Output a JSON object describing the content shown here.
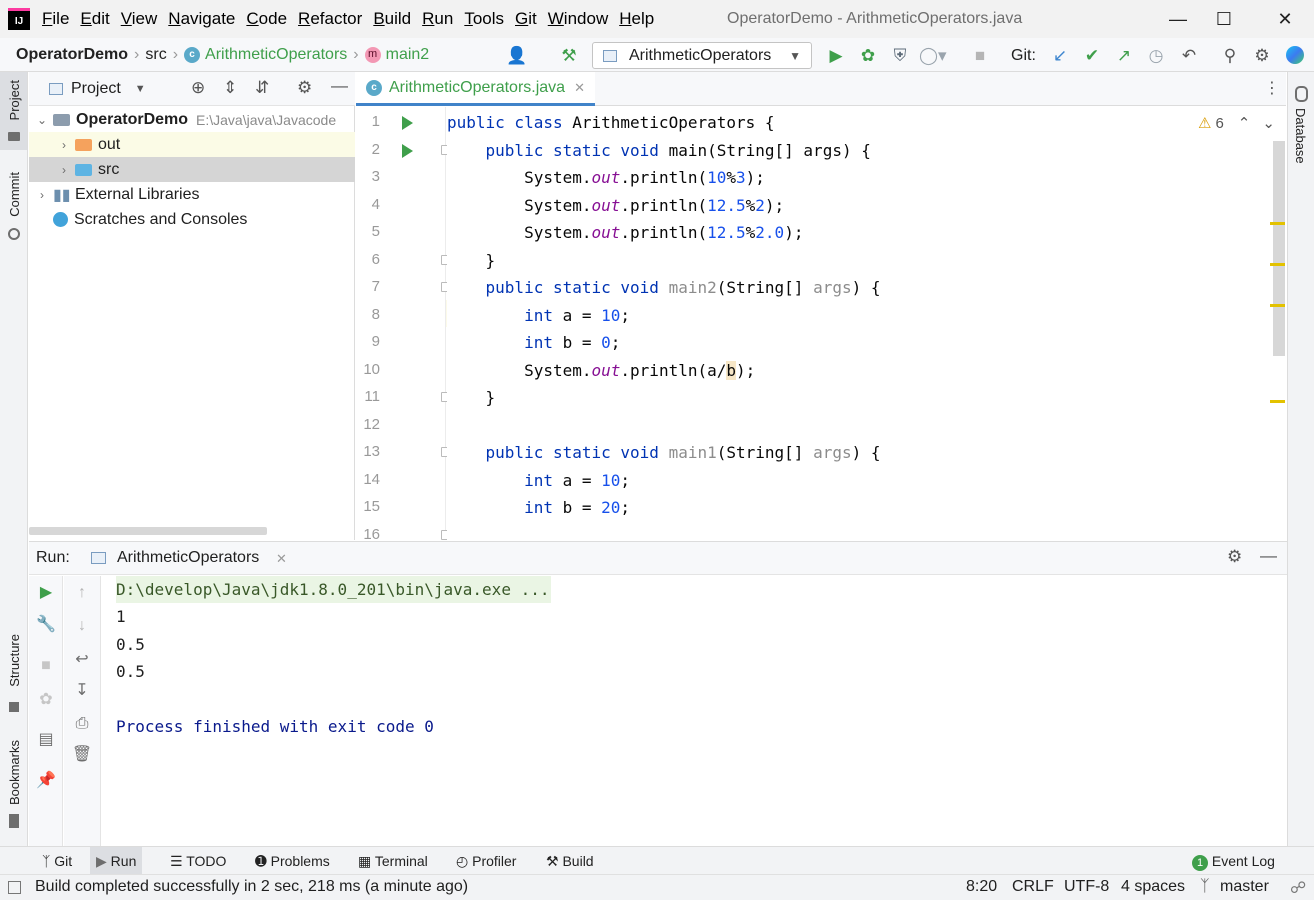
{
  "window": {
    "title": "OperatorDemo - ArithmeticOperators.java",
    "menu": [
      "File",
      "Edit",
      "View",
      "Navigate",
      "Code",
      "Refactor",
      "Build",
      "Run",
      "Tools",
      "Git",
      "Window",
      "Help"
    ]
  },
  "breadcrumb": {
    "project": "OperatorDemo",
    "folder": "src",
    "class": "ArithmeticOperators",
    "method": "main2"
  },
  "toolbar": {
    "run_config": "ArithmeticOperators",
    "git_label": "Git:"
  },
  "left_stripe": {
    "project": "Project",
    "commit": "Commit",
    "structure": "Structure",
    "bookmarks": "Bookmarks"
  },
  "right_stripe": {
    "database": "Database"
  },
  "project_panel": {
    "title": "Project",
    "tree": [
      {
        "label": "OperatorDemo",
        "path": "E:\\Java\\java\\Javacode"
      },
      {
        "label": "out"
      },
      {
        "label": "src"
      },
      {
        "label": "External Libraries"
      },
      {
        "label": "Scratches and Consoles"
      }
    ]
  },
  "editor": {
    "tab": "ArithmeticOperators.java",
    "warnings": "6",
    "current_line": 8,
    "line_numbers": [
      "1",
      "2",
      "3",
      "4",
      "5",
      "6",
      "7",
      "8",
      "9",
      "10",
      "11",
      "12",
      "13",
      "14",
      "15",
      "16"
    ]
  },
  "run_panel": {
    "label": "Run:",
    "tab": "ArithmeticOperators",
    "command": "D:\\develop\\Java\\jdk1.8.0_201\\bin\\java.exe ...",
    "output": [
      "1",
      "0.5",
      "0.5"
    ],
    "exit_message": "Process finished with exit code 0"
  },
  "bottom_tabs": [
    "Git",
    "Run",
    "TODO",
    "Problems",
    "Terminal",
    "Profiler",
    "Build"
  ],
  "event_log": {
    "label": "Event Log",
    "count": "1"
  },
  "status": {
    "message": "Build completed successfully in 2 sec, 218 ms (a minute ago)",
    "position": "8:20",
    "line_sep": "CRLF",
    "encoding": "UTF-8",
    "indent": "4 spaces",
    "branch": "master"
  },
  "colors": {
    "accent": "#4083c9",
    "run_green": "#3f9f4b",
    "keyword": "#0033b3",
    "number": "#1750eb",
    "field": "#871094",
    "console_text": "#0a1a8c"
  }
}
